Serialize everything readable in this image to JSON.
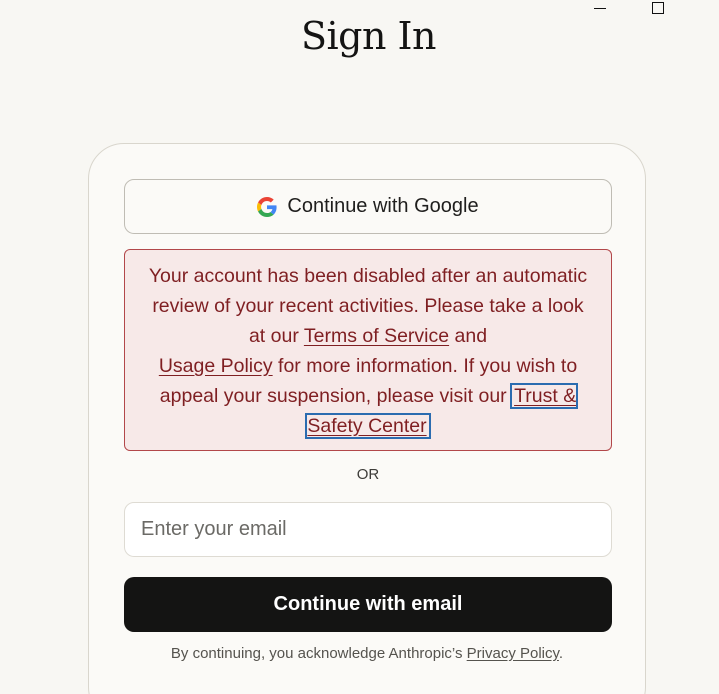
{
  "window_controls": {
    "minimize_symbol": "",
    "maximize_symbol": ""
  },
  "header": {
    "title": "Sign In"
  },
  "google_button": {
    "label": "Continue with Google",
    "icon": "google-icon"
  },
  "error": {
    "text_1": "Your account has been disabled after an automatic review of your recent activities. Please take a look at our ",
    "link_terms": "Terms of Service",
    "text_2": " and ",
    "link_usage": "Usage Policy",
    "text_3": " for more information. If you wish to appeal your suspension, please visit our ",
    "link_trust": "Trust & Safety Center",
    "text_color": "#7f1f22",
    "background": "#f7e9e8",
    "border_color": "#b2474a"
  },
  "divider": {
    "label": "OR"
  },
  "email": {
    "placeholder": "Enter your email",
    "value": ""
  },
  "email_button": {
    "label": "Continue with email",
    "background": "#141413"
  },
  "legal": {
    "text": "By continuing, you acknowledge Anthropic’s ",
    "link_privacy": "Privacy Policy",
    "suffix": "."
  }
}
